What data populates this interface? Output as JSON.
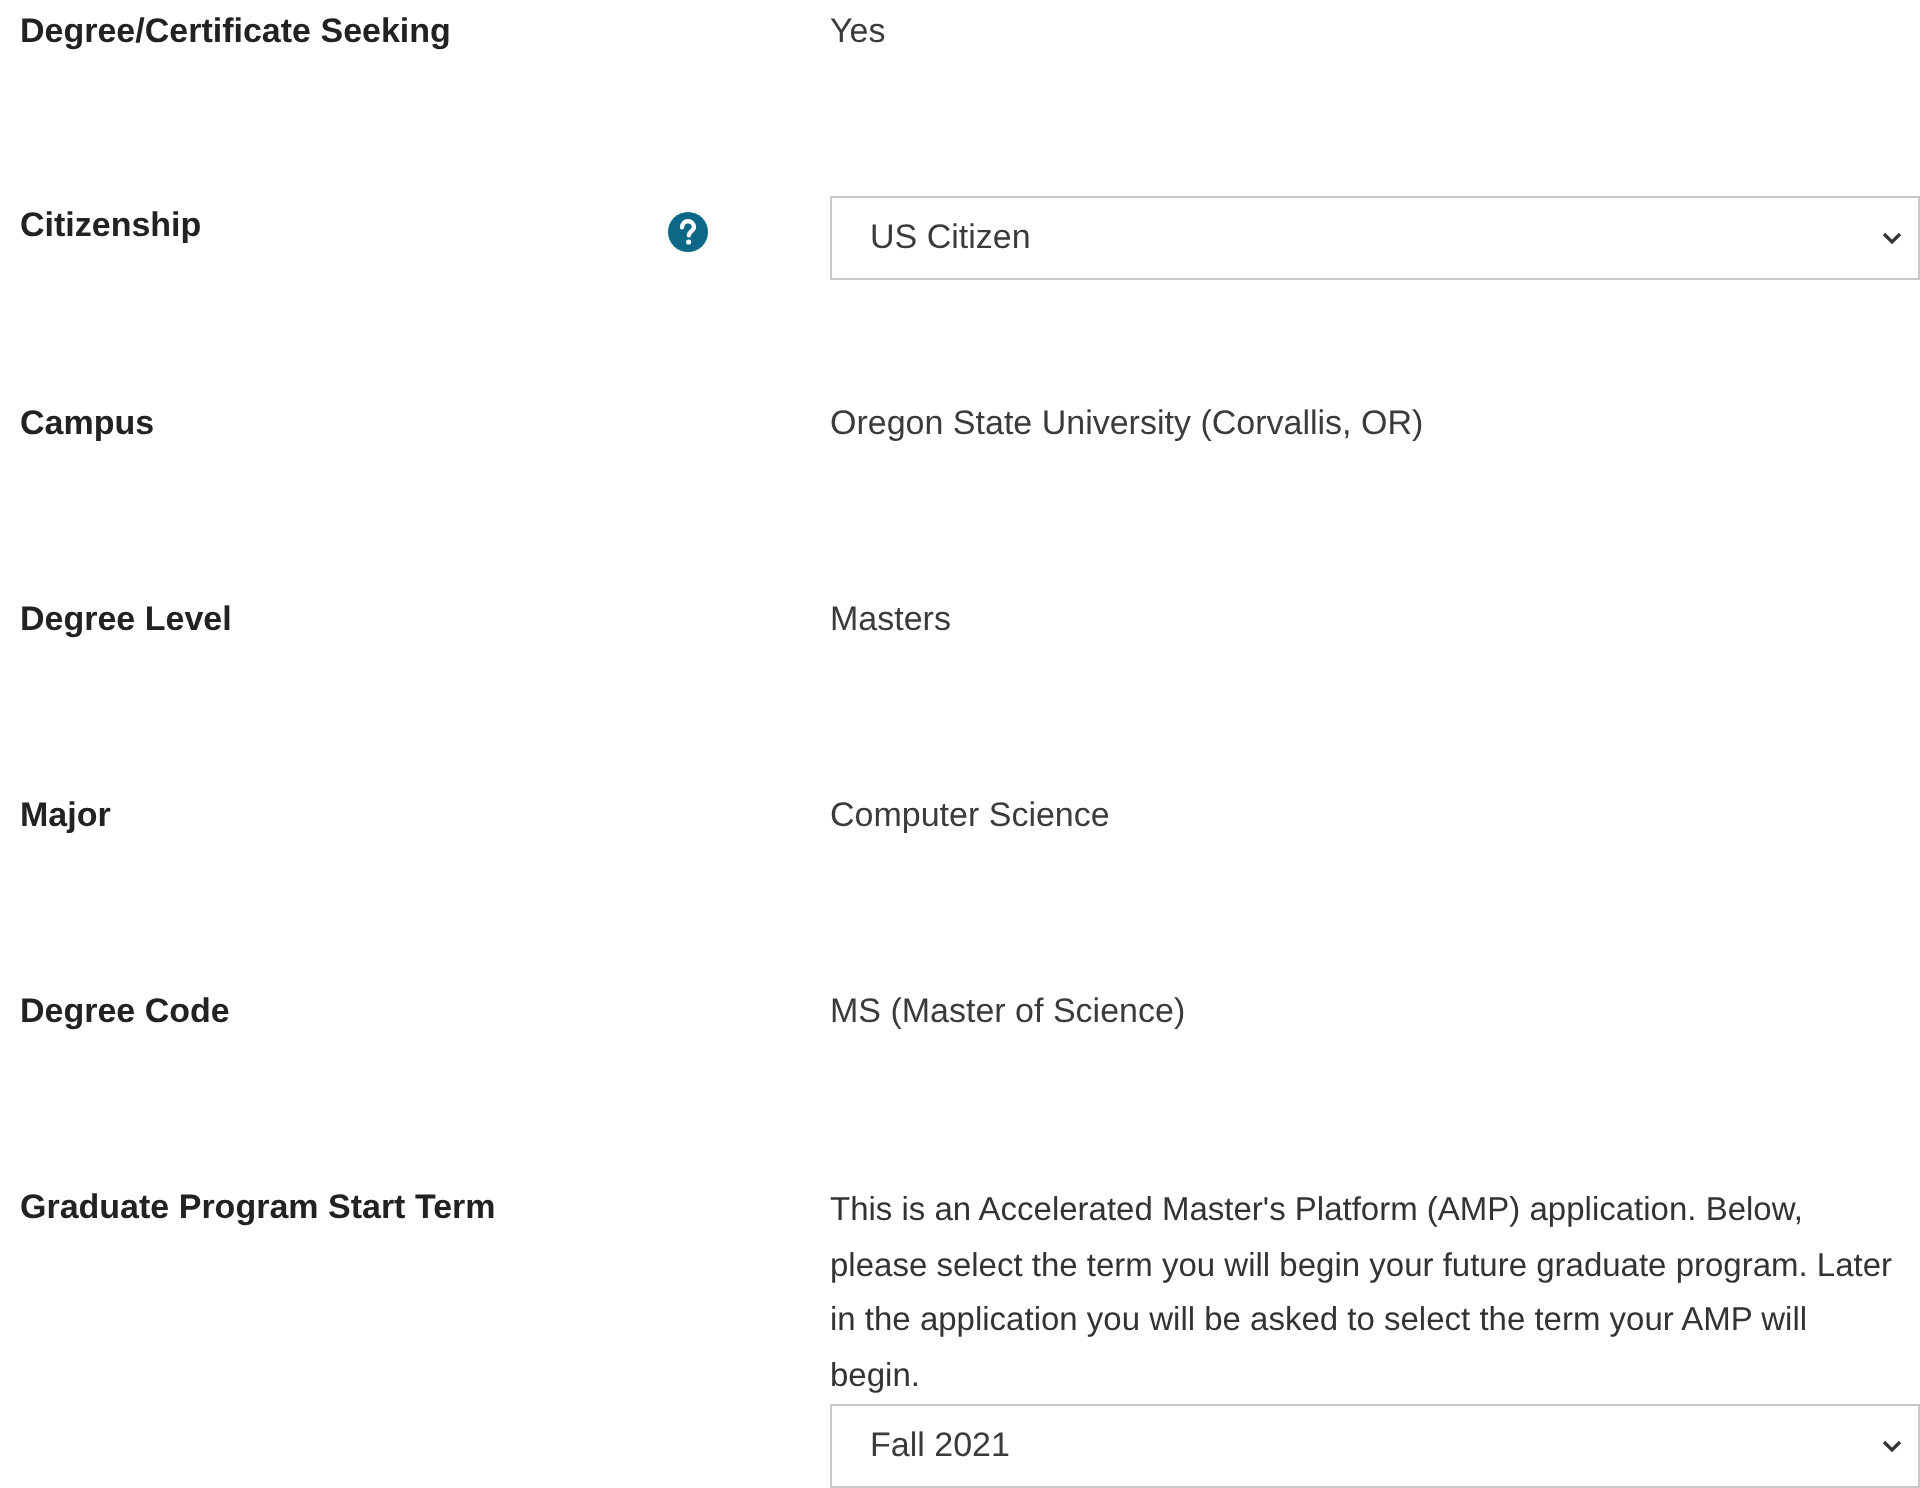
{
  "fields": [
    {
      "kind": "text",
      "label": "Degree/Certificate Seeking",
      "help": false,
      "value": "Yes"
    },
    {
      "kind": "select",
      "label": "Citizenship",
      "help": true,
      "value": "US Citizen"
    },
    {
      "kind": "text",
      "label": "Campus",
      "help": false,
      "value": "Oregon State University (Corvallis, OR)"
    },
    {
      "kind": "text",
      "label": "Degree Level",
      "help": false,
      "value": "Masters"
    },
    {
      "kind": "text",
      "label": "Major",
      "help": false,
      "value": "Computer Science"
    },
    {
      "kind": "text",
      "label": "Degree Code",
      "help": false,
      "value": "MS (Master of Science)"
    },
    {
      "kind": "note-select",
      "label": "Graduate Program Start Term",
      "help": false,
      "note": "This is an Accelerated Master's Platform (AMP) application. Below, please select the term you will begin your future graduate program. Later in the application you will be asked to select the term your AMP will begin.",
      "value": "Fall 2021"
    }
  ]
}
